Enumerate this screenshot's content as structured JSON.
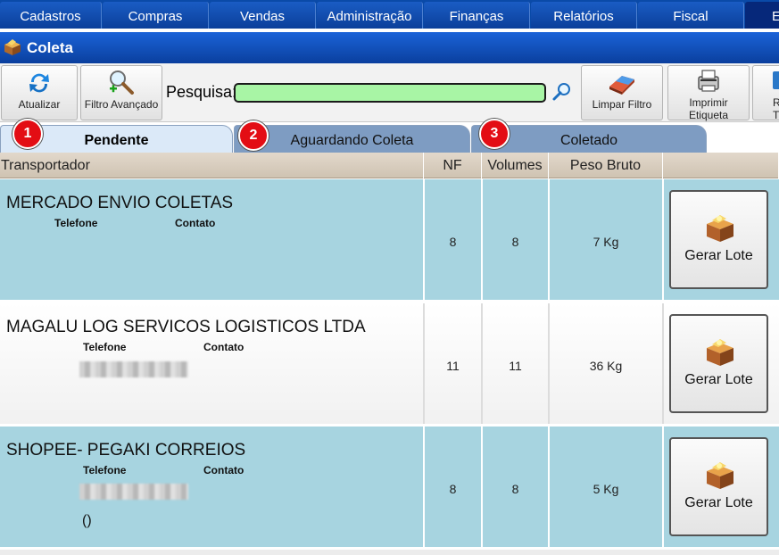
{
  "menu": {
    "items": [
      "Cadastros",
      "Compras",
      "Vendas",
      "Administração",
      "Finanças",
      "Relatórios",
      "Fiscal",
      "E"
    ]
  },
  "window": {
    "title": "Coleta"
  },
  "toolbar": {
    "refresh_label": "Atualizar",
    "advanced_filter_label": "Filtro Avançado",
    "search_label": "Pesquisa:",
    "search_value": "",
    "clear_filter_label": "Limpar Filtro",
    "print_label_line1": "Imprimir",
    "print_label_line2": "Etiqueta",
    "cut_label_line1": "R",
    "cut_label_line2": "T"
  },
  "tabs": [
    {
      "number": "1",
      "label": "Pendente",
      "active": true
    },
    {
      "number": "2",
      "label": "Aguardando Coleta",
      "active": false
    },
    {
      "number": "3",
      "label": "Coletado",
      "active": false
    }
  ],
  "grid": {
    "columns": [
      "Transportador",
      "NF",
      "Volumes",
      "Peso Bruto",
      ""
    ],
    "phone_label": "Telefone",
    "contact_label": "Contato",
    "action_label": "Gerar Lote",
    "rows": [
      {
        "carrier": "MERCADO ENVIO COLETAS",
        "nf": "8",
        "volumes": "8",
        "weight": "7 Kg",
        "phone_extra": ""
      },
      {
        "carrier": "MAGALU LOG SERVICOS LOGISTICOS LTDA",
        "nf": "11",
        "volumes": "11",
        "weight": "36 Kg",
        "phone_extra": ""
      },
      {
        "carrier": "SHOPEE- PEGAKI CORREIOS",
        "nf": "8",
        "volumes": "8",
        "weight": "5 Kg",
        "phone_extra": "()"
      }
    ]
  },
  "colors": {
    "menu_blue": "#0a4aa8",
    "row_blue": "#a7d4e0",
    "search_green": "#a8f5a5",
    "tab_badge_red": "#e30d14"
  }
}
